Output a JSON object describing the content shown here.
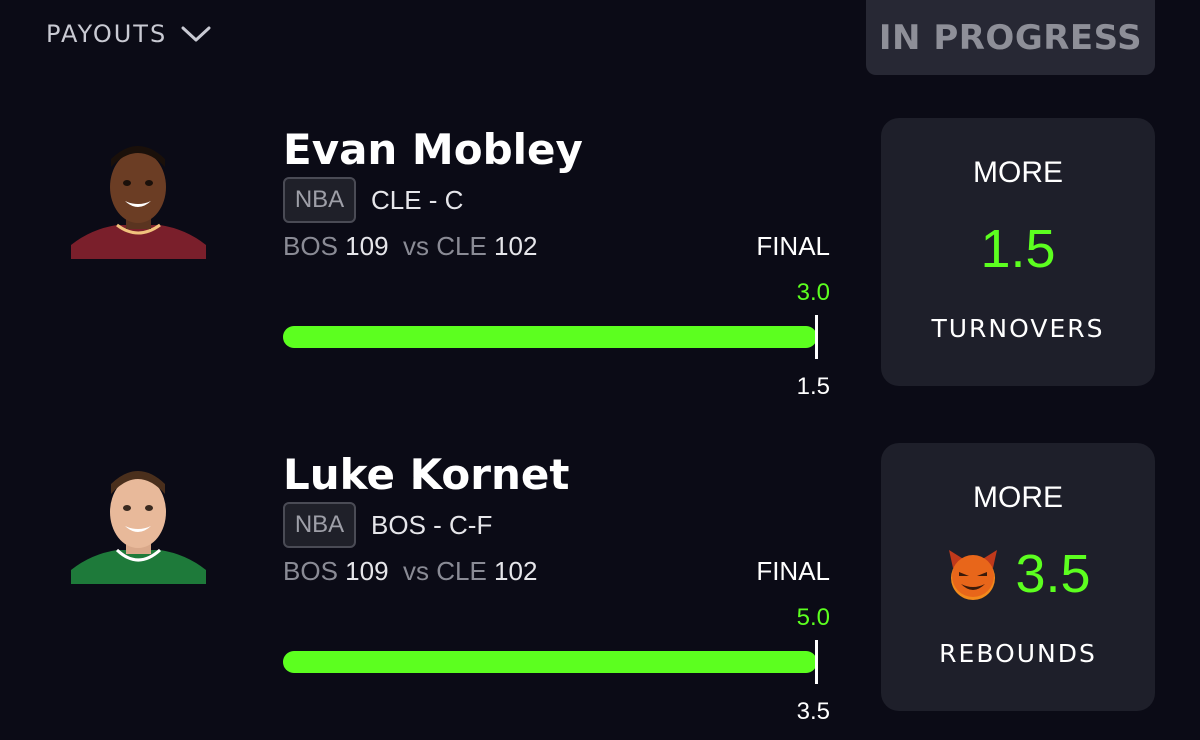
{
  "header": {
    "payouts_label": "PAYOUTS",
    "status": "IN PROGRESS"
  },
  "picks": [
    {
      "player": "Evan Mobley",
      "league": "NBA",
      "team_pos": "CLE - C",
      "team1": "BOS",
      "score1": "109",
      "vs": "vs",
      "team2": "CLE",
      "score2": "102",
      "status": "FINAL",
      "actual": "3.0",
      "line": "1.5",
      "direction": "MORE",
      "stat": "TURNOVERS",
      "progress_fraction": 1.0,
      "jersey_color": "#7a1f2b"
    },
    {
      "player": "Luke Kornet",
      "league": "NBA",
      "team_pos": "BOS - C-F",
      "team1": "BOS",
      "score1": "109",
      "vs": "vs",
      "team2": "CLE",
      "score2": "102",
      "status": "FINAL",
      "actual": "5.0",
      "line": "3.5",
      "direction": "MORE",
      "stat": "REBOUNDS",
      "progress_fraction": 1.0,
      "jersey_color": "#1e7a3a"
    }
  ],
  "colors": {
    "accent_green": "#5cff1f",
    "background": "#0b0b16",
    "card": "#1e1f2a"
  },
  "icons": {
    "payouts_chevron": "chevron-down-icon",
    "demon": "devil-emoji-icon"
  }
}
